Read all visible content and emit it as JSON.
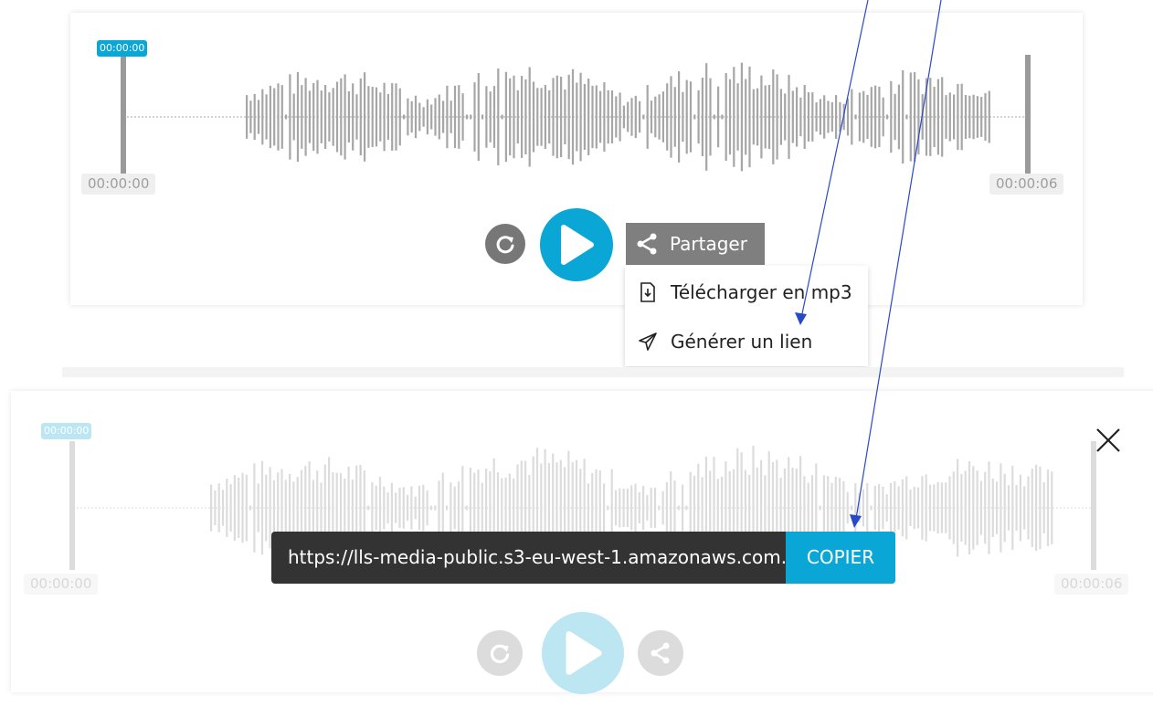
{
  "player_top": {
    "current_time_badge": "00:00:00",
    "start_time": "00:00:00",
    "end_time": "00:00:06",
    "share_label": "Partager",
    "menu": {
      "items": [
        {
          "label": "Télécharger en mp3",
          "icon": "download-file-icon"
        },
        {
          "label": "Générer un lien",
          "icon": "send-icon"
        }
      ]
    }
  },
  "player_bottom": {
    "current_time_badge": "00:00:00",
    "start_time": "00:00:00",
    "end_time": "00:00:06",
    "link_url": "https://lls-media-public.s3-eu-west-1.amazonaws.com.",
    "copy_label": "COPIER"
  },
  "colors": {
    "accent": "#0aa6d6",
    "accent_faded": "#bde6f3",
    "waveform": "#a6a6a6",
    "waveform_faded": "#dcdcdc",
    "share_bg": "#7f7f7f",
    "arrow": "#2a49c8"
  }
}
